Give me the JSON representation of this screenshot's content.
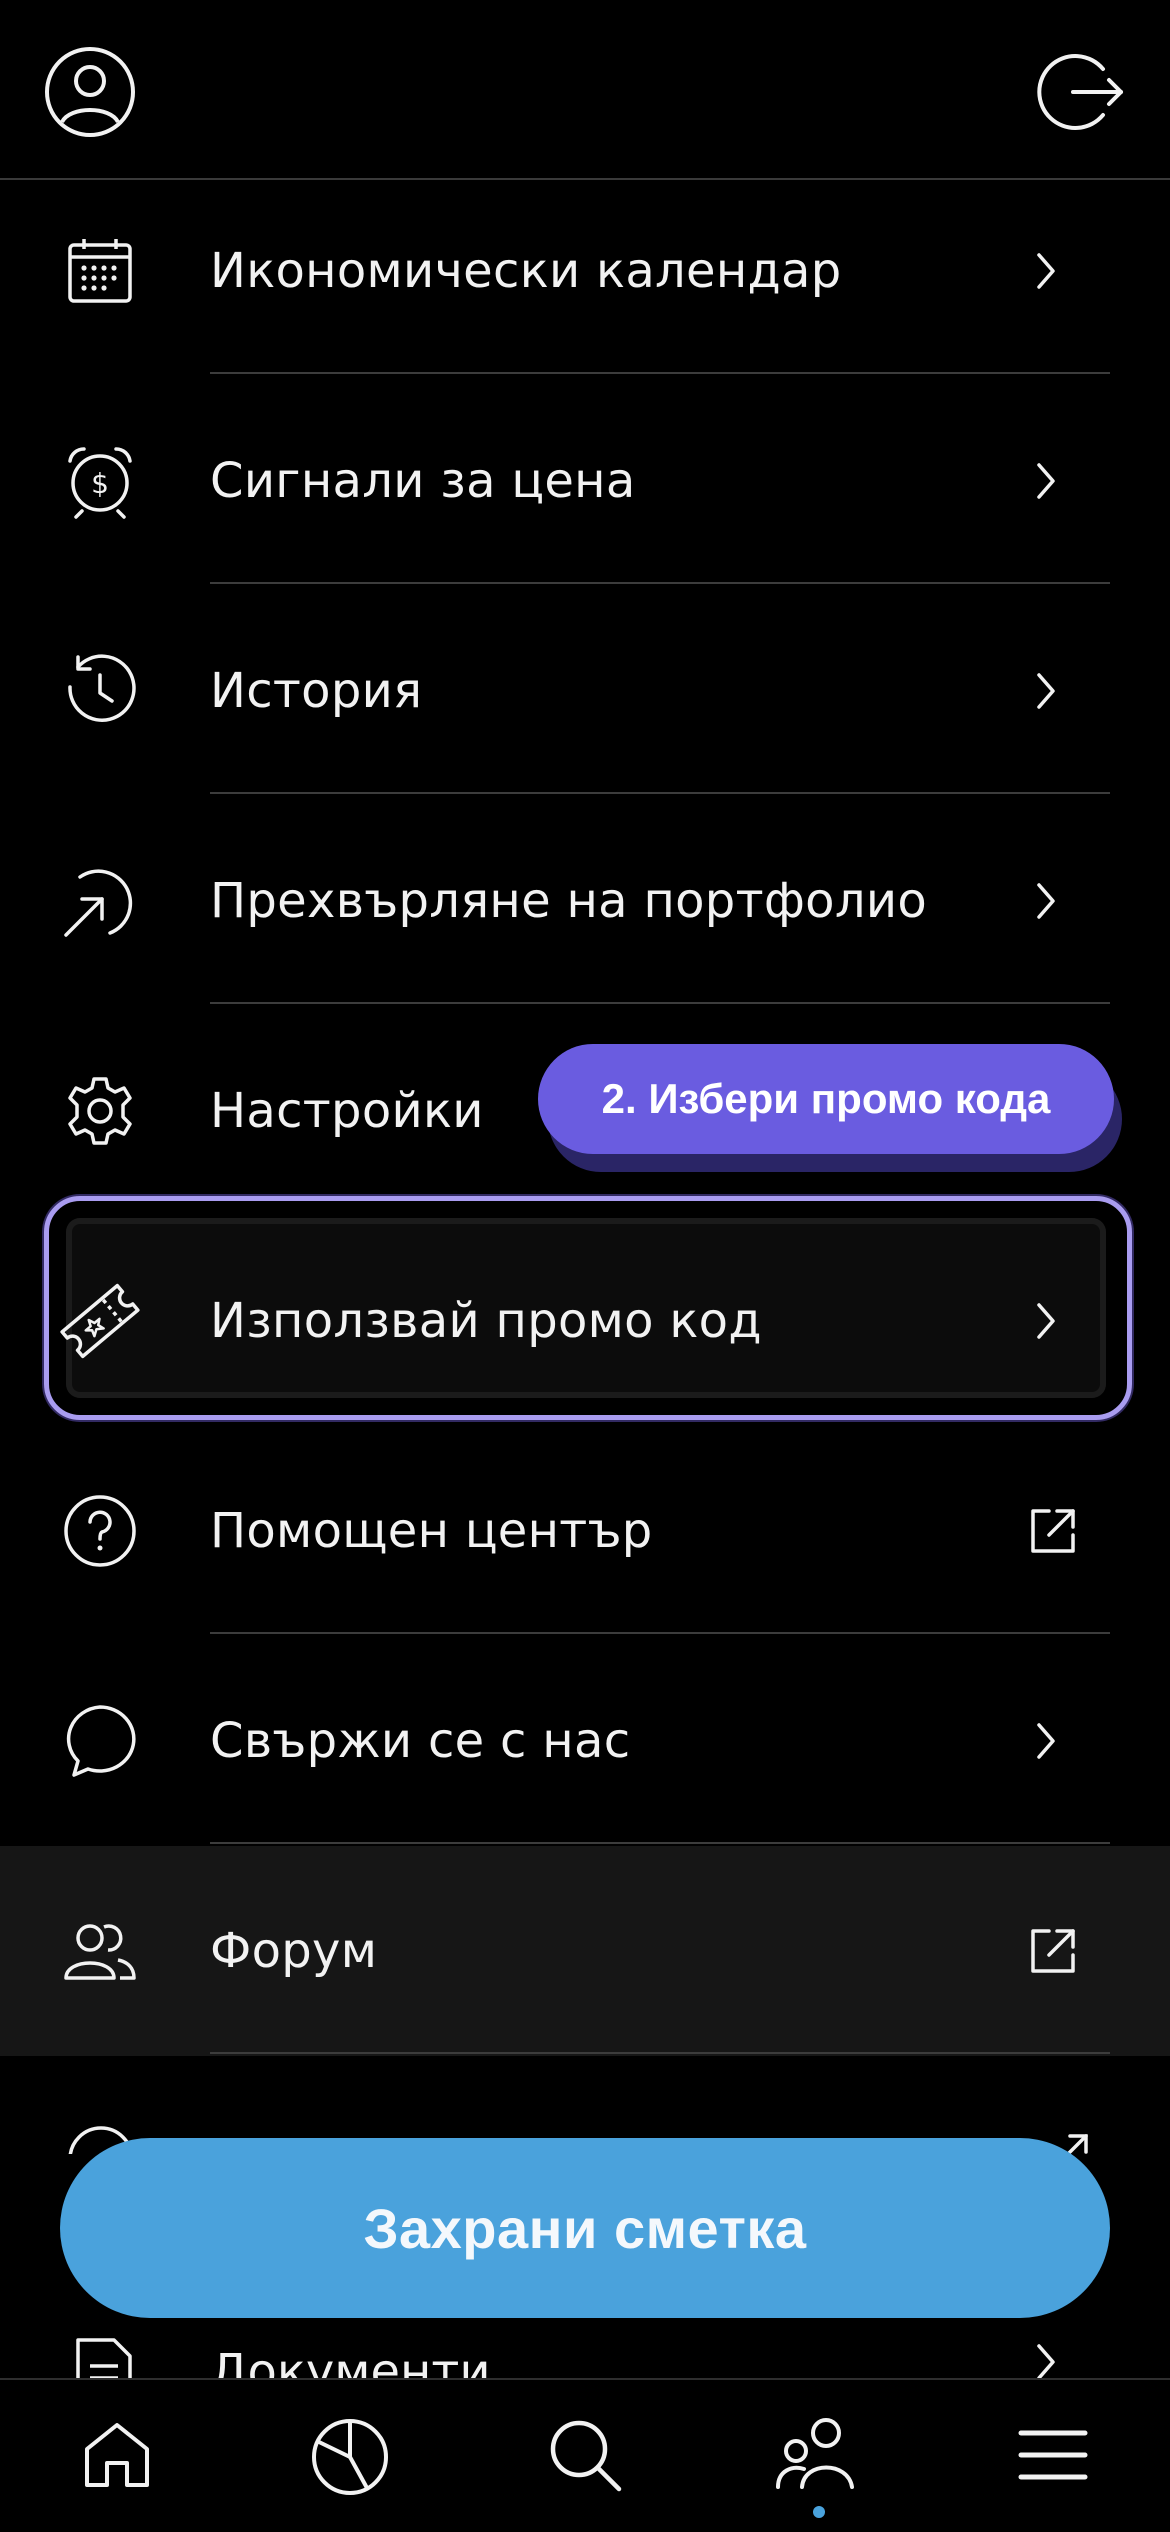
{
  "menu": {
    "items": [
      {
        "label": "Икономически календар",
        "icon": "calendar-icon",
        "trailing": "chevron"
      },
      {
        "label": "Сигнали за цена",
        "icon": "price-alert-clock-icon",
        "trailing": "chevron"
      },
      {
        "label": "История",
        "icon": "history-icon",
        "trailing": "chevron"
      },
      {
        "label": "Прехвърляне на портфолио",
        "icon": "transfer-arrow-icon",
        "trailing": "chevron"
      },
      {
        "label": "Настройки",
        "icon": "settings-gear-icon",
        "trailing": "none"
      },
      {
        "label": "Използвай промо код",
        "icon": "ticket-icon",
        "trailing": "chevron"
      },
      {
        "label": "Помощен център",
        "icon": "help-question-icon",
        "trailing": "external"
      },
      {
        "label": "Свържи се с нас",
        "icon": "chat-bubble-icon",
        "trailing": "chevron"
      },
      {
        "label": "Форум",
        "icon": "forum-users-icon",
        "trailing": "external"
      },
      {
        "label": "Документи",
        "icon": "document-icon",
        "trailing": "chevron"
      }
    ]
  },
  "callout": {
    "text": "2. Избери промо кода"
  },
  "save_button": {
    "label": "Захрани сметка"
  },
  "colors": {
    "background": "#000000",
    "callout": "#6a5ce0",
    "focus_border": "#a99cf0",
    "save_button": "#4aa2dc"
  },
  "tabbar": {
    "items": [
      {
        "icon": "home-icon"
      },
      {
        "icon": "portfolio-pie-icon"
      },
      {
        "icon": "search-icon"
      },
      {
        "icon": "community-icon",
        "active": true
      },
      {
        "icon": "menu-icon"
      }
    ]
  }
}
